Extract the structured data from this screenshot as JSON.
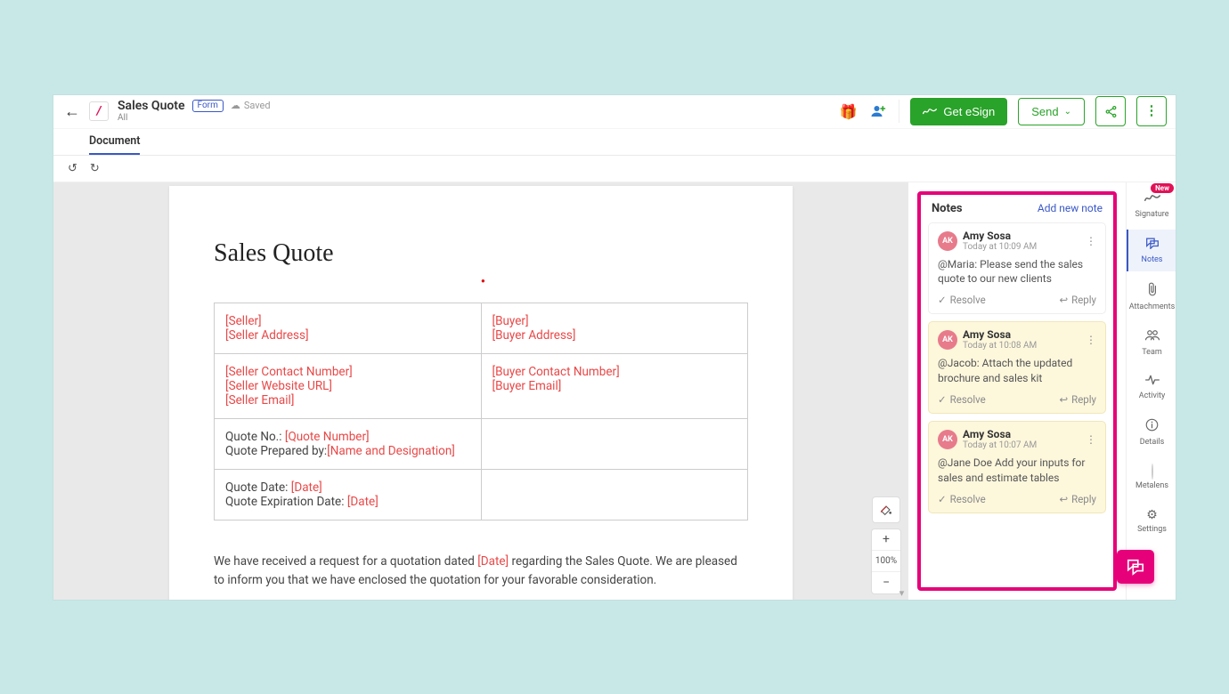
{
  "header": {
    "back_icon": "←",
    "logo_char": "/",
    "title": "Sales Quote",
    "form_badge": "Form",
    "saved_label": "Saved",
    "subtitle": "All",
    "get_esign_label": "Get eSign",
    "send_label": "Send"
  },
  "subtabs": {
    "document": "Document"
  },
  "toolbar": {
    "undo": "↺",
    "redo": "↻"
  },
  "page": {
    "heading": "Sales Quote",
    "seller": "[Seller]",
    "seller_address": "[Seller Address]",
    "buyer": "[Buyer]",
    "buyer_address": "[Buyer Address]",
    "seller_contact": "[Seller Contact Number]",
    "seller_website": "[Seller Website URL]",
    "seller_email": "[Seller Email]",
    "buyer_contact": "[Buyer Contact Number]",
    "buyer_email": "[Buyer Email]",
    "quote_no_label": "Quote No.: ",
    "quote_no_ph": "[Quote Number]",
    "prepared_by_label": "Quote Prepared by:",
    "prepared_by_ph": "[Name and Designation]",
    "quote_date_label": "Quote Date: ",
    "quote_date_ph": "[Date]",
    "quote_exp_label": "Quote Expiration Date: ",
    "quote_exp_ph": "[Date]",
    "body_pre": "We have received a request for a quotation dated ",
    "body_date_ph": "[Date]",
    "body_post": " regarding the Sales Quote. We are pleased to inform you that we have enclosed the quotation for your favorable consideration."
  },
  "zoom": {
    "level": "100%",
    "plus": "+",
    "minus": "−"
  },
  "notes": {
    "panel_title": "Notes",
    "add_new": "Add new note",
    "resolve_label": "Resolve",
    "reply_label": "Reply",
    "items": [
      {
        "avatar": "AK",
        "author": "Amy Sosa",
        "timestamp": "Today at 10:09 AM",
        "body": "@Maria: Please send the sales quote to our new clients",
        "highlight": false
      },
      {
        "avatar": "AK",
        "author": "Amy Sosa",
        "timestamp": "Today at 10:08 AM",
        "body": "@Jacob: Attach the updated brochure and sales kit",
        "highlight": true
      },
      {
        "avatar": "AK",
        "author": "Amy Sosa",
        "timestamp": "Today at 10:07 AM",
        "body": "@Jane Doe Add your inputs for sales and estimate tables",
        "highlight": true
      }
    ]
  },
  "rail": {
    "new_badge": "New",
    "signature": "Signature",
    "notes": "Notes",
    "attachments": "Attachments",
    "team": "Team",
    "activity": "Activity",
    "details": "Details",
    "metalens": "Metalens",
    "settings": "Settings"
  }
}
